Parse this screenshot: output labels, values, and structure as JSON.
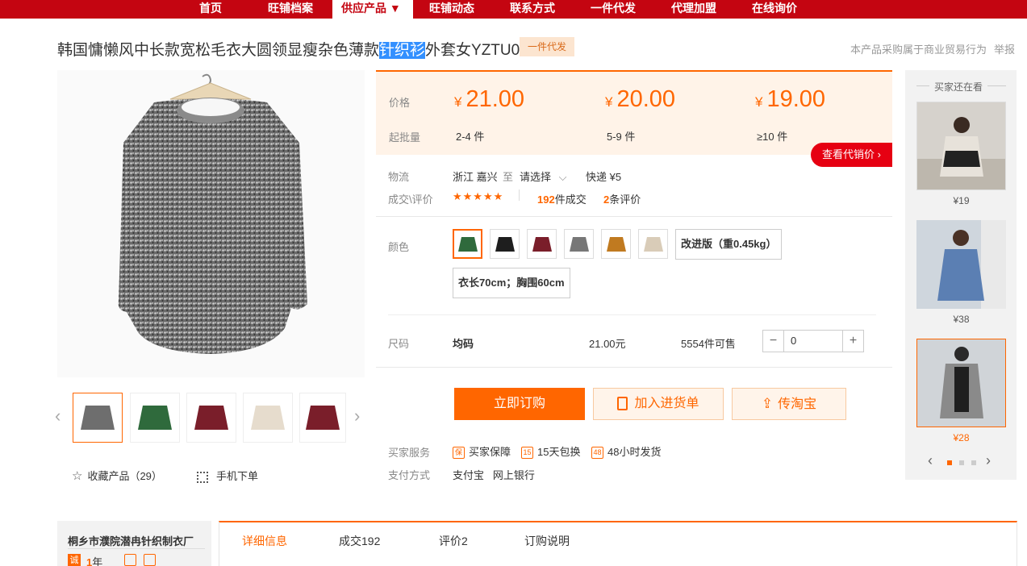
{
  "nav": {
    "items": [
      "首页",
      "旺铺档案",
      "供应产品 ▼",
      "旺铺动态",
      "联系方式",
      "一件代发",
      "代理加盟",
      "在线询价"
    ]
  },
  "product": {
    "title_pre": "韩国慵懒风中长款宽松毛衣大圆领显瘦杂色薄款",
    "title_sel": "针织衫",
    "title_post": "外套女YZTU08",
    "badge": "一件代发",
    "trade_note": "本产品采购属于商业贸易行为",
    "report": "举报"
  },
  "pricing": {
    "price_label": "价格",
    "qty_label": "起批量",
    "currency": "¥",
    "tiers": [
      {
        "price": "21.00",
        "qty": "2-4 件"
      },
      {
        "price": "20.00",
        "qty": "5-9 件"
      },
      {
        "price": "19.00",
        "qty": "≥10 件"
      }
    ],
    "agent_price_btn": "查看代销价 ›"
  },
  "logistics": {
    "label": "物流",
    "from": "浙江 嘉兴",
    "to_word": "至",
    "select": "请选择",
    "express": "快递 ¥5"
  },
  "deals": {
    "label": "成交\\评价",
    "stars": "★★★★★",
    "deals_count": "192",
    "deals_suffix": "件成交",
    "review_count": "2",
    "review_suffix": "条评价"
  },
  "color": {
    "label": "颜色",
    "swatch_colors": [
      "#2f6a3c",
      "#1e1e1e",
      "#7a1e2a",
      "#777777",
      "#c07a20",
      "#d9ccb8"
    ],
    "option_a": "改进版（重0.45kg）",
    "option_b": "衣长70cm；胸围60cm"
  },
  "size": {
    "label": "尺码",
    "value": "均码",
    "price": "21.00元",
    "stock": "5554件可售",
    "minus": "−",
    "qty": "0",
    "plus": "+"
  },
  "actions": {
    "buy": "立即订购",
    "add_cart": "加入进货单",
    "taobao": "传淘宝"
  },
  "services": {
    "label": "买家服务",
    "items": [
      {
        "icon": "保",
        "text": "买家保障"
      },
      {
        "icon": "15",
        "text": "15天包换"
      },
      {
        "icon": "48",
        "text": "48小时发货"
      }
    ],
    "pay_label": "支付方式",
    "pay_methods": "支付宝   网上银行"
  },
  "left_actions": {
    "favorite": "收藏产品（29）",
    "mobile": "手机下单"
  },
  "sidebar": {
    "title": "买家还在看",
    "items": [
      {
        "price": "¥19"
      },
      {
        "price": "¥38"
      },
      {
        "price": "¥28"
      }
    ]
  },
  "company": {
    "name": "桐乡市濮院潜冉针织制衣厂",
    "year_badge": "诚",
    "years": "1",
    "years_suffix": "年"
  },
  "tabs": [
    "详细信息",
    "成交192",
    "评价2",
    "订购说明"
  ]
}
